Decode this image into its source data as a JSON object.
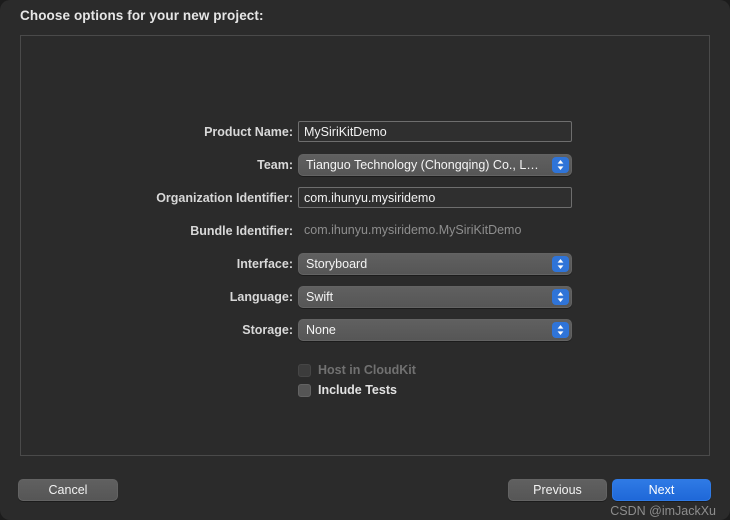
{
  "window": {
    "sheet_title": "Choose options for your new project:",
    "accent_color": "#2f7ae5",
    "background_color": "#2b2b2b",
    "panel_border_color": "#4a4a4a"
  },
  "form": {
    "rows": [
      {
        "label": "Product Name:",
        "type": "textfield",
        "value": "MySiriKitDemo",
        "placeholder": "",
        "name": "product-name"
      },
      {
        "label": "Team:",
        "type": "popup",
        "value": "Tianguo Technology (Chongqing) Co., L…",
        "name": "team"
      },
      {
        "label": "Organization Identifier:",
        "type": "textfield",
        "value": "com.ihunyu.mysiridemo",
        "placeholder": "",
        "name": "organization-identifier"
      },
      {
        "label": "Bundle Identifier:",
        "type": "static",
        "value": "com.ihunyu.mysiridemo.MySiriKitDemo",
        "name": "bundle-identifier"
      },
      {
        "label": "Interface:",
        "type": "popup",
        "value": "Storyboard",
        "name": "interface"
      },
      {
        "label": "Language:",
        "type": "popup",
        "value": "Swift",
        "name": "language"
      },
      {
        "label": "Storage:",
        "type": "popup",
        "value": "None",
        "name": "storage"
      }
    ],
    "checkboxes": [
      {
        "label": "Host in CloudKit",
        "checked": false,
        "enabled": false,
        "name": "host-in-cloudkit"
      },
      {
        "label": "Include Tests",
        "checked": false,
        "enabled": true,
        "name": "include-tests"
      }
    ]
  },
  "buttons": {
    "cancel": "Cancel",
    "previous": "Previous",
    "next": "Next"
  },
  "watermark": {
    "text": "CSDN @imJackXu"
  }
}
